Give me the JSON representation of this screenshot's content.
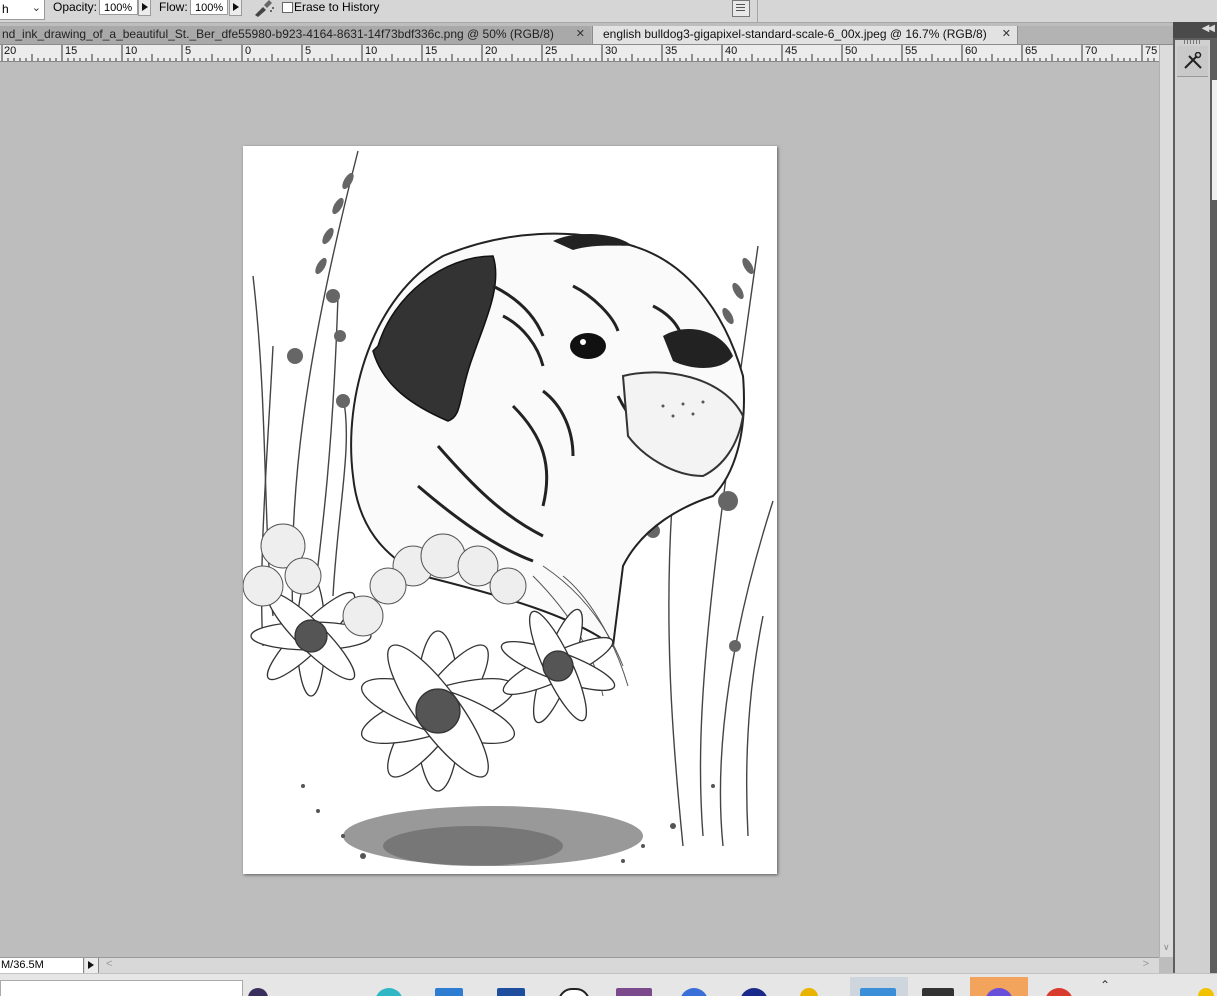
{
  "options_bar": {
    "brush_mode_value": "h",
    "opacity_label": "Opacity:",
    "opacity_value": "100%",
    "flow_label": "Flow:",
    "flow_value": "100%",
    "erase_to_history_label": "Erase to History",
    "erase_to_history_checked": false
  },
  "tabs": [
    {
      "label": "nd_ink_drawing_of_a_beautiful_St._Ber_dfe55980-b923-4164-8631-14f73bdf336c.png @ 50% (RGB/8)",
      "active": false
    },
    {
      "label": "english bulldog3-gigapixel-standard-scale-6_00x.jpeg @ 16.7% (RGB/8)",
      "active": true
    }
  ],
  "ruler": {
    "numbers": [
      "20",
      "15",
      "10",
      "5",
      "0",
      "5",
      "10",
      "15",
      "20",
      "25",
      "30",
      "35",
      "40",
      "45",
      "50",
      "55",
      "60",
      "65",
      "70",
      "75"
    ]
  },
  "status_bar": {
    "doc_size": "M/36.5M"
  },
  "colors": {
    "canvas_bg": "#bdbdbd",
    "active_tab_bg": "#e2e2e2",
    "inactive_tab_bg": "#a9a9a9",
    "panel_dark": "#5e5e5e"
  },
  "icons": [
    "airbrush-icon",
    "panel-icon",
    "close-icon",
    "play-icon",
    "tools-icon",
    "collapse-icon"
  ]
}
